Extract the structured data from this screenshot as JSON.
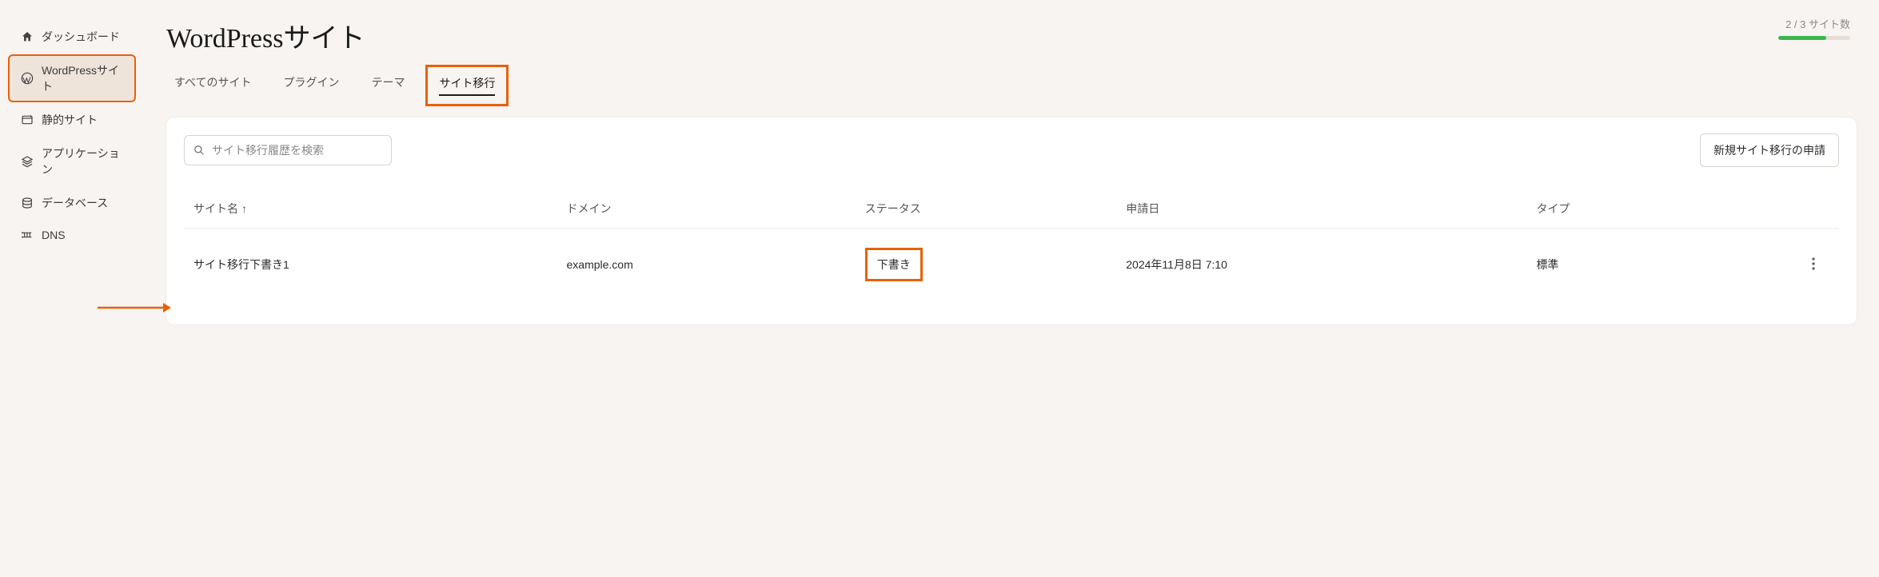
{
  "sidebar": {
    "items": [
      {
        "label": "ダッシュボード"
      },
      {
        "label": "WordPressサイト"
      },
      {
        "label": "静的サイト"
      },
      {
        "label": "アプリケーション"
      },
      {
        "label": "データベース"
      },
      {
        "label": "DNS"
      }
    ]
  },
  "header": {
    "title": "WordPressサイト",
    "quota_text": "2 / 3 サイト数",
    "quota_used": 2,
    "quota_total": 3
  },
  "tabs": [
    {
      "label": "すべてのサイト"
    },
    {
      "label": "プラグイン"
    },
    {
      "label": "テーマ"
    },
    {
      "label": "サイト移行"
    }
  ],
  "panel": {
    "search_placeholder": "サイト移行履歴を検索",
    "new_button": "新規サイト移行の申請",
    "columns": {
      "site_name": "サイト名",
      "domain": "ドメイン",
      "status": "ステータス",
      "requested": "申請日",
      "type": "タイプ"
    },
    "rows": [
      {
        "site_name": "サイト移行下書き1",
        "domain": "example.com",
        "status": "下書き",
        "requested": "2024年11月8日 7:10",
        "type": "標準"
      }
    ]
  },
  "icons": {
    "sort_arrow": "↑"
  },
  "highlight_color": "#e8610b"
}
